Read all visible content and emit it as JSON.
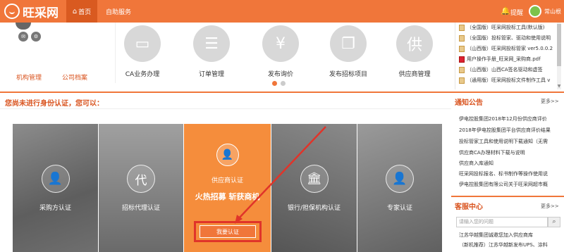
{
  "header": {
    "logo_text": "旺采网",
    "nav_home": "首页",
    "nav_self_service": "自助服务",
    "remind": "提醒",
    "user_name": "常山根"
  },
  "profile": {
    "link_org": "机构管理",
    "link_archive": "公司档案"
  },
  "features": [
    {
      "label": "CA业务办理",
      "icon": "ca-icon"
    },
    {
      "label": "订单管理",
      "icon": "order-icon"
    },
    {
      "label": "发布询价",
      "icon": "yen-icon"
    },
    {
      "label": "发布招标项目",
      "icon": "bid-icon"
    },
    {
      "label": "供应商管理",
      "icon": "supplier-icon"
    }
  ],
  "files": [
    "（全国版）旺采网投标工具(默认版)",
    "（全国版）投标管家、驱动和使用说明",
    "（山西版）旺采网投标管家 ver5.0.0.2",
    "用户操作手册_旺采网_采购商.pdf",
    "（山西版）山西CA签名驱动和虚签",
    "（通用版）旺采网投标文件制作工具 v"
  ],
  "main": {
    "notice": "您尚未进行身份认证，您可以："
  },
  "cards": [
    {
      "label": "采购方认证"
    },
    {
      "label": "招标代理认证"
    },
    {
      "label": "供应商认证",
      "slogan": "火热招募 斩获商机",
      "button": "我要认证"
    },
    {
      "label": "银行/担保机构认证"
    },
    {
      "label": "专家认证"
    }
  ],
  "announcements": {
    "title": "通知公告",
    "more": "更多>>",
    "items": [
      "伊电控股集团2018年12月份供应商评价",
      "2018年伊电控股集团平台供应商评价结果",
      "投标管家工具和使用说明下载通知（无需",
      "供应商CA办理材料下载与说明",
      "供应商入库通知",
      "旺采网投标报名、标书制作等操作使用说",
      "伊电控股集团有限公司关于旺采网超市概"
    ]
  },
  "service": {
    "title": "客服中心",
    "more": "更多>>",
    "search_placeholder": "请输入您的问题",
    "items": [
      "江苏华越集团诚邀您加入供应商库",
      "（新机推荐）江苏华越新发布UPS、涂料"
    ]
  }
}
